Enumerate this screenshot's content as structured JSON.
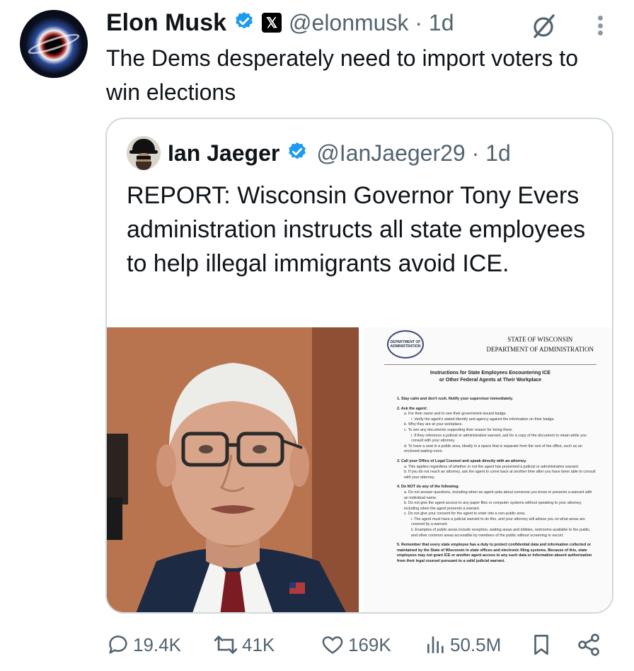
{
  "post": {
    "author_name": "Elon Musk",
    "handle_time": "@elonmusk · 1d",
    "text": "The Dems desperately need to import voters to win elections"
  },
  "quoted_post": {
    "author_name": "Ian Jaeger",
    "handle_time": "@IanJaeger29 · 1d",
    "text": "REPORT: Wisconsin Governor Tony Evers administration instructs all state employees to help illegal immigrants avoid ICE."
  },
  "document": {
    "seal_text": "DEPARTMENT OF ADMINISTRATION",
    "header_line1": "STATE OF WISCONSIN",
    "header_line2": "DEPARTMENT OF ADMINISTRATION",
    "title_line1": "Instructions for State Employees Encountering ICE",
    "title_line2": "or Other Federal Agents at Their Workplace",
    "lines": [
      {
        "cls": "sec",
        "text": "1.  Stay calm and don't rush. Notify your supervisor immediately."
      },
      {
        "cls": "sec",
        "text": "2.  Ask the agent:"
      },
      {
        "cls": "sub",
        "text": "a.  For their name and to see their government-issued badge."
      },
      {
        "cls": "sub2",
        "text": "i.  Verify the agent's stated identity and agency against the information on their badge."
      },
      {
        "cls": "sub",
        "text": "b.  Why they are at your workplace."
      },
      {
        "cls": "sub",
        "text": "c.  To see any documents supporting their reason for being there."
      },
      {
        "cls": "sub2",
        "text": "i.  If they reference a judicial or administrative warrant, ask for a copy of the document to retain while you consult with your attorney."
      },
      {
        "cls": "sub",
        "text": "d.  To have a seat in a public area, ideally in a space that is separate from the rest of the office, such as an enclosed waiting room."
      },
      {
        "cls": "sec",
        "text": "3.  Call your Office of Legal Counsel and speak directly with an attorney."
      },
      {
        "cls": "sub",
        "text": "a.  This applies regardless of whether or not the agent has presented a judicial or administrative warrant."
      },
      {
        "cls": "sub",
        "text": "b.  If you do not reach an attorney, ask the agent to come back at another time after you have been able to consult with your attorney."
      },
      {
        "cls": "sec",
        "text": "4.  Do NOT do any of the following:"
      },
      {
        "cls": "sub",
        "text": "a.  Do not answer questions, including when an agent asks about someone you know or presents a warrant with an individual name."
      },
      {
        "cls": "sub",
        "text": "b.  Do not give the agent access to any paper files or computer systems without speaking to your attorney, including when the agent presents a warrant."
      },
      {
        "cls": "sub",
        "text": "c.  Do not give your consent for the agent to enter into a non-public area."
      },
      {
        "cls": "sub2",
        "text": "i.  The agent must have a judicial warrant to do this, and your attorney will advise you on what areas are covered by a warrant."
      },
      {
        "cls": "sub2",
        "text": "ii.  Examples of public areas include reception, waiting areas and lobbies, restrooms available to the public, and other common areas accessible by members of the public without screening or escort."
      },
      {
        "cls": "sec",
        "text": "5.  Remember that every state employee has a duty to protect confidential data and information collected or maintained by the State of Wisconsin in state offices and electronic filing systems. Because of this, state employees may not grant ICE or another agent access to any such data or information absent authorization from their legal counsel pursuant to a valid judicial warrant."
      }
    ]
  },
  "actions": {
    "replies": "19.4K",
    "reposts": "41K",
    "likes": "169K",
    "views": "50.5M"
  },
  "icons": [
    "verified-badge-icon",
    "x-logo-icon",
    "grok-icon",
    "more-icon",
    "reply-icon",
    "repost-icon",
    "like-icon",
    "views-icon",
    "bookmark-icon",
    "share-icon"
  ],
  "colors": {
    "verified": "#1d9bf0",
    "muted": "#536471",
    "border": "#cfd9de"
  }
}
